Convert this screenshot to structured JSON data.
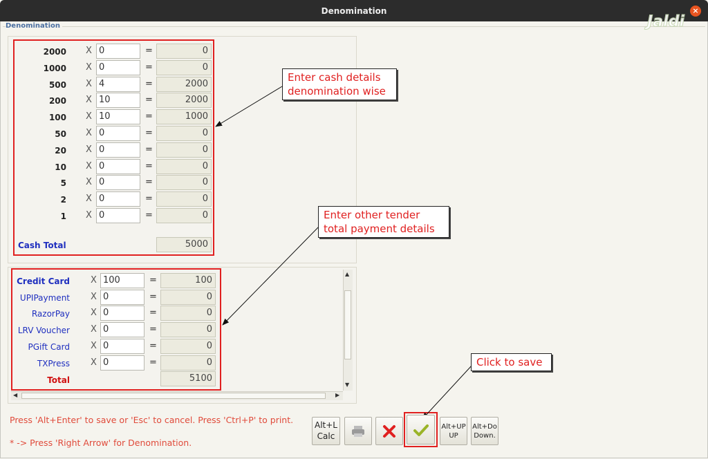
{
  "window": {
    "title": "Denomination",
    "close_glyph": "×"
  },
  "fieldset_label": "Denomination",
  "logo": "Jaldi",
  "cash": {
    "rows": [
      {
        "denom": "2000",
        "x": "X",
        "qty": "0",
        "eq": "=",
        "amount": "0"
      },
      {
        "denom": "1000",
        "x": "X",
        "qty": "0",
        "eq": "=",
        "amount": "0"
      },
      {
        "denom": "500",
        "x": "X",
        "qty": "4",
        "eq": "=",
        "amount": "2000"
      },
      {
        "denom": "200",
        "x": "X",
        "qty": "10",
        "eq": "=",
        "amount": "2000"
      },
      {
        "denom": "100",
        "x": "X",
        "qty": "10",
        "eq": "=",
        "amount": "1000"
      },
      {
        "denom": "50",
        "x": "X",
        "qty": "0",
        "eq": "=",
        "amount": "0"
      },
      {
        "denom": "20",
        "x": "X",
        "qty": "0",
        "eq": "=",
        "amount": "0"
      },
      {
        "denom": "10",
        "x": "X",
        "qty": "0",
        "eq": "=",
        "amount": "0"
      },
      {
        "denom": "5",
        "x": "X",
        "qty": "0",
        "eq": "=",
        "amount": "0"
      },
      {
        "denom": "2",
        "x": "X",
        "qty": "0",
        "eq": "=",
        "amount": "0"
      },
      {
        "denom": "1",
        "x": "X",
        "qty": "0",
        "eq": "=",
        "amount": "0"
      }
    ],
    "total_label": "Cash Total",
    "total_value": "5000"
  },
  "tender": {
    "rows": [
      {
        "name": "Credit Card",
        "x": "X",
        "qty": "100",
        "eq": "=",
        "amount": "100"
      },
      {
        "name": "UPIPayment",
        "x": "X",
        "qty": "0",
        "eq": "=",
        "amount": "0"
      },
      {
        "name": "RazorPay",
        "x": "X",
        "qty": "0",
        "eq": "=",
        "amount": "0"
      },
      {
        "name": "LRV Voucher",
        "x": "X",
        "qty": "0",
        "eq": "=",
        "amount": "0"
      },
      {
        "name": "PGift Card",
        "x": "X",
        "qty": "0",
        "eq": "=",
        "amount": "0"
      },
      {
        "name": "TXPress",
        "x": "X",
        "qty": "0",
        "eq": "=",
        "amount": "0"
      }
    ],
    "total_label": "Total",
    "total_value": "5100"
  },
  "callouts": {
    "cash": "Enter cash details\ndenomination wise",
    "tender": "Enter other tender\ntotal payment details",
    "save": "Click to save"
  },
  "hints": {
    "line1": "Press 'Alt+Enter' to save or 'Esc' to cancel. Press 'Ctrl+P' to print.",
    "line2": "* -> Press 'Right Arrow' for Denomination."
  },
  "buttons": {
    "calc": "Alt+L\nCalc",
    "up": "Alt+UP\nUP",
    "down": "Alt+Do\nDown."
  },
  "colors": {
    "accent_red": "#e02020",
    "label_blue": "#1f2fbf",
    "total_red": "#d01010",
    "check_green": "#9ab428"
  }
}
